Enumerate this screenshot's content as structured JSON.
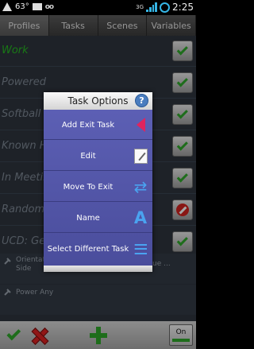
{
  "status_bar": {
    "battery_text": "63°",
    "network": "3G",
    "time": "2:25",
    "icons": [
      "warning-icon",
      "mail-icon",
      "oo-icon",
      "signal-icon",
      "battery-icon"
    ]
  },
  "tabs": [
    {
      "label": "Profiles",
      "active": true
    },
    {
      "label": "Tasks",
      "active": false
    },
    {
      "label": "Scenes",
      "active": false
    },
    {
      "label": "Variables",
      "active": false
    }
  ],
  "profiles": [
    {
      "name": "Work",
      "enabled": true,
      "active": true
    },
    {
      "name": "Powered",
      "enabled": true,
      "active": false
    },
    {
      "name": "Softball",
      "enabled": true,
      "active": false
    },
    {
      "name": "Known H",
      "enabled": true,
      "active": false
    },
    {
      "name": "In Meetin",
      "enabled": true,
      "active": false
    },
    {
      "name": "Random",
      "enabled": false,
      "active": false
    },
    {
      "name": "UCD: Gea",
      "enabled": true,
      "active": false
    }
  ],
  "expanded_contexts": {
    "context_a": "Orientat",
    "context_a2": "Side",
    "context_b": "ue ...",
    "context_c": "Power Any"
  },
  "dialog": {
    "title": "Task Options",
    "options": [
      {
        "label": "Add Exit Task",
        "icon": "triangle-left-icon"
      },
      {
        "label": "Edit",
        "icon": "edit-icon"
      },
      {
        "label": "Move To Exit",
        "icon": "sync-icon"
      },
      {
        "label": "Name",
        "icon": "letter-a-icon"
      },
      {
        "label": "Select Different Task",
        "icon": "list-icon"
      }
    ]
  },
  "toolbar": {
    "onoff_label": "On"
  },
  "colors": {
    "accent_blue": "#4aa3f0",
    "enabled_green": "#26b821",
    "dialog_bg": "#5c5fb4",
    "exit_red": "#e0245e"
  }
}
